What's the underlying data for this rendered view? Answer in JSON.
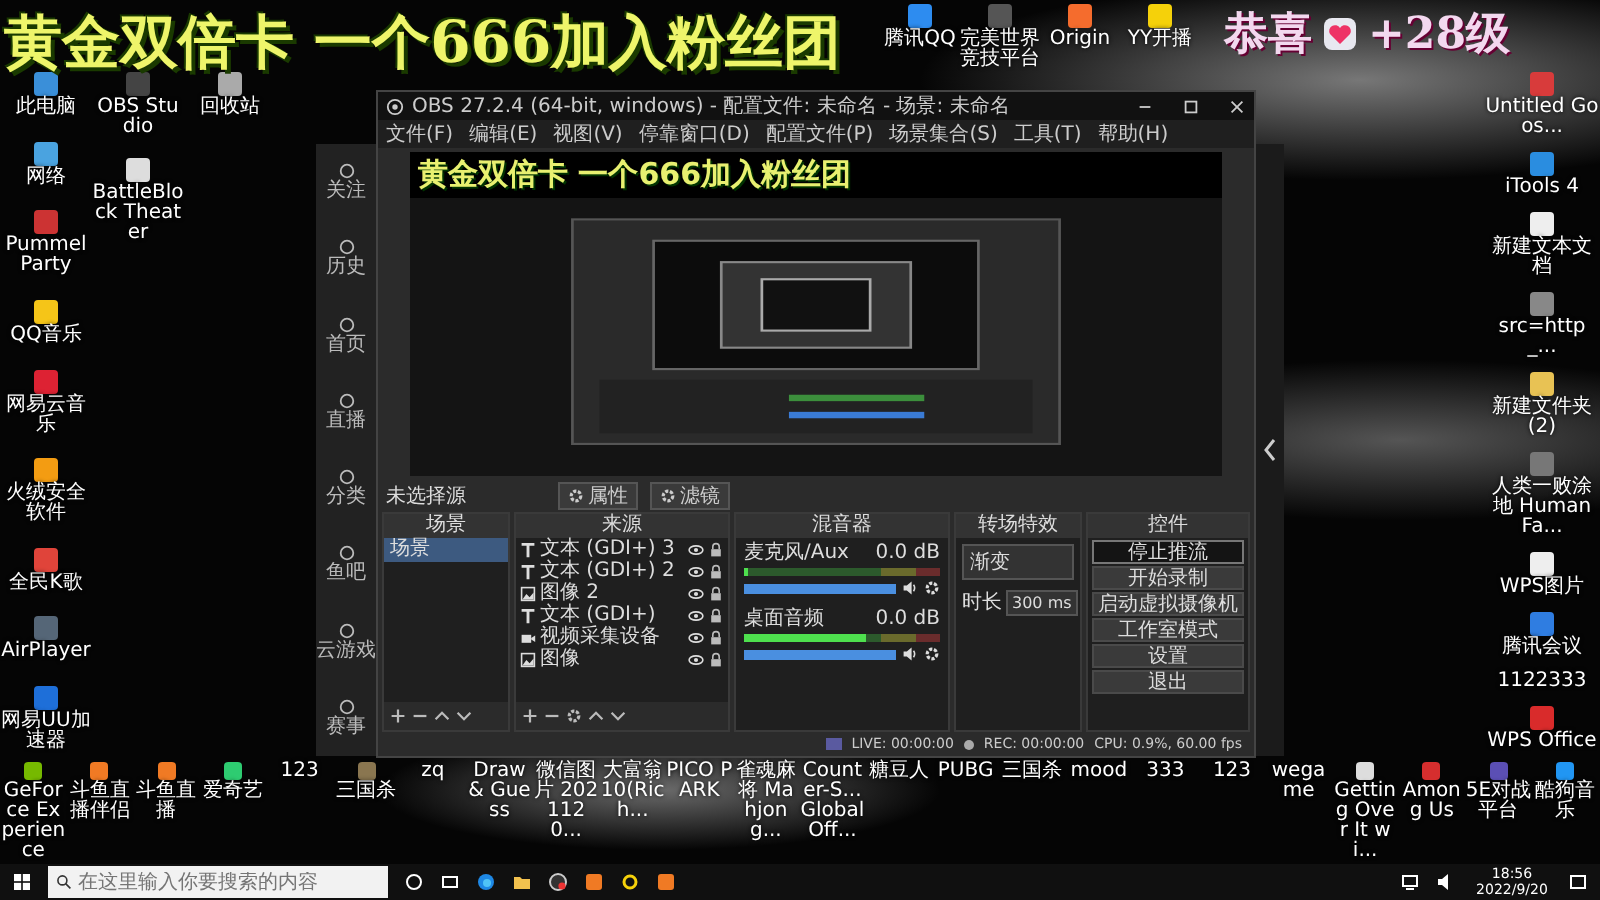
{
  "overlay": {
    "banner": "黄金双倍卡 一个666加入粉丝团",
    "congrats": "恭喜",
    "level": "+28级"
  },
  "desktop": {
    "top_row": [
      {
        "label": "腾讯QQ",
        "color": "#2d8cf0"
      },
      {
        "label": "完美世界竞技平台",
        "color": "#555555"
      },
      {
        "label": "Origin",
        "color": "#f56c2d"
      },
      {
        "label": "YY开播",
        "color": "#f5d10a"
      }
    ],
    "left_columns": [
      {
        "icons": [
          {
            "label": "此电脑",
            "color": "#3a8fd9"
          },
          {
            "label": "网络",
            "color": "#4aa3e0"
          },
          {
            "label": "Pummel Party",
            "color": "#cc3333"
          },
          {
            "label": "QQ音乐",
            "color": "#f5c518"
          },
          {
            "label": "网易云音乐",
            "color": "#dd2233"
          },
          {
            "label": "火绒安全软件",
            "color": "#f39c12"
          },
          {
            "label": "全民K歌",
            "color": "#e0443a"
          },
          {
            "label": "AirPlayer",
            "color": "#556677"
          },
          {
            "label": "网易UU加速器",
            "color": "#1e6fd9"
          }
        ]
      },
      {
        "icons": [
          {
            "label": "OBS Studio",
            "color": "#444444"
          },
          {
            "label": "BattleBlock Theater",
            "color": "#dddddd"
          }
        ]
      },
      {
        "icons": [
          {
            "label": "回收站",
            "color": "#aaaaaa"
          }
        ]
      }
    ],
    "right_column": [
      {
        "label": "Untitled Goos...",
        "color": "#d83b3b"
      },
      {
        "label": "iTools 4",
        "color": "#2a8de0"
      },
      {
        "label": "新建文本文档",
        "color": "#eeeeee"
      },
      {
        "label": "src=http_...",
        "color": "#888888"
      },
      {
        "label": "新建文件夹 (2)",
        "color": "#e8c254"
      },
      {
        "label": "人类一败涂地 Human Fa...",
        "color": "#777777"
      },
      {
        "label": "WPS图片",
        "color": "#eeeeee"
      },
      {
        "label": "腾讯会议",
        "color": "#2f7de1"
      },
      {
        "label": "1122333"
      },
      {
        "label": "WPS Office",
        "color": "#d92b2b"
      }
    ],
    "bottom_row": [
      {
        "label": "GeForce Experience",
        "color": "#76b900"
      },
      {
        "label": "斗鱼直播伴侣",
        "color": "#f07a24"
      },
      {
        "label": "斗鱼直播",
        "color": "#f07a24"
      },
      {
        "label": "爱奇艺",
        "color": "#2ecc71"
      },
      {
        "label": "123"
      },
      {
        "label": "三国杀",
        "color": "#8a7650"
      },
      {
        "label": "zq"
      },
      {
        "label": "Draw & Guess"
      },
      {
        "label": "微信图片 2021120..."
      },
      {
        "label": "大富翁10(Rich..."
      },
      {
        "label": "PICO PARK"
      },
      {
        "label": "雀魂麻将 Mahjong..."
      },
      {
        "label": "Counter-S... Global Off..."
      },
      {
        "label": "糖豆人"
      },
      {
        "label": "PUBG"
      },
      {
        "label": "三国杀"
      },
      {
        "label": "mood"
      },
      {
        "label": "333"
      },
      {
        "label": "123"
      },
      {
        "label": "wegame"
      },
      {
        "label": "Getting Over It wi...",
        "color": "#dddddd"
      },
      {
        "label": "Among Us",
        "color": "#d62e2e"
      },
      {
        "label": "5E对战平台",
        "color": "#5b4fb5"
      },
      {
        "label": "酷狗音乐",
        "color": "#2196f3"
      }
    ]
  },
  "browser": {
    "sidebar": [
      {
        "label": "关注"
      },
      {
        "label": "历史"
      },
      {
        "label": "首页"
      },
      {
        "label": "直播"
      },
      {
        "label": "分类"
      },
      {
        "label": "鱼吧"
      },
      {
        "label": "云游戏"
      },
      {
        "label": "赛事"
      }
    ]
  },
  "obs": {
    "title": "OBS 27.2.4 (64-bit, windows) - 配置文件: 未命名 - 场景: 未命名",
    "menu": [
      "文件(F)",
      "编辑(E)",
      "视图(V)",
      "停靠窗口(D)",
      "配置文件(P)",
      "场景集合(S)",
      "工具(T)",
      "帮助(H)"
    ],
    "preview_banner": "黄金双倍卡 一个666加入粉丝团",
    "no_source": "未选择源",
    "source_buttons": [
      "属性",
      "滤镜"
    ],
    "scenes": {
      "title": "场景",
      "items": [
        {
          "label": "场景",
          "selected": true
        }
      ]
    },
    "sources": {
      "title": "来源",
      "items": [
        {
          "label": "文本 (GDI+) 3",
          "kind": "text"
        },
        {
          "label": "文本 (GDI+) 2",
          "kind": "text"
        },
        {
          "label": "图像 2",
          "kind": "image"
        },
        {
          "label": "文本 (GDI+)",
          "kind": "text"
        },
        {
          "label": "视频采集设备",
          "kind": "video"
        },
        {
          "label": "图像",
          "kind": "image"
        }
      ]
    },
    "mixer": {
      "title": "混音器",
      "channels": [
        {
          "name": "麦克风/Aux",
          "reading": "0.0 dB",
          "meter": {
            "level": 0
          },
          "volume": {
            "level": 1
          }
        },
        {
          "name": "桌面音频",
          "reading": "0.0 dB",
          "meter": {
            "level": 0.62
          },
          "volume": {
            "level": 1
          }
        }
      ]
    },
    "transitions": {
      "title": "转场特效",
      "selected": "渐变",
      "duration_label": "时长",
      "duration": "300 ms"
    },
    "controls": {
      "title": "控件",
      "buttons": [
        {
          "label": "停止推流",
          "active": true
        },
        {
          "label": "开始录制",
          "active": false
        },
        {
          "label": "启动虚拟摄像机",
          "active": false
        },
        {
          "label": "工作室模式",
          "active": false
        },
        {
          "label": "设置",
          "active": false
        },
        {
          "label": "退出",
          "active": false
        }
      ]
    },
    "status": {
      "live": "LIVE: 00:00:00",
      "rec": "REC: 00:00:00",
      "cpu": "CPU: 0.9%, 60.00 fps"
    }
  },
  "taskbar": {
    "search_placeholder": "在这里输入你要搜索的内容",
    "time": "18:56",
    "date": "2022/9/20"
  }
}
